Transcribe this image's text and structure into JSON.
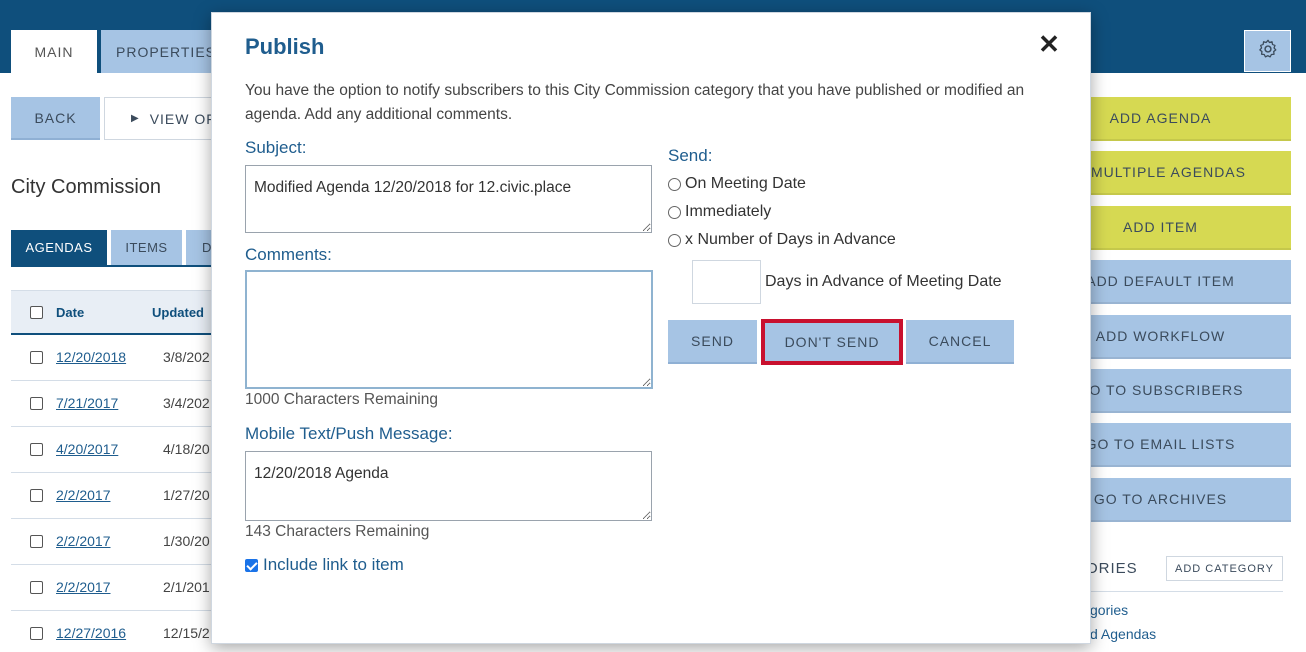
{
  "app": {
    "tabs": [
      {
        "label": "MAIN"
      },
      {
        "label": "PROPERTIES"
      }
    ],
    "back_label": "BACK",
    "view_label": "VIEW OF",
    "heading": "City Commission",
    "subtabs": [
      {
        "label": "AGENDAS"
      },
      {
        "label": "ITEMS"
      },
      {
        "label": "D"
      }
    ],
    "table": {
      "headers": {
        "date": "Date",
        "updated": "Updated"
      },
      "rows": [
        {
          "date": "12/20/2018",
          "updated": "3/8/202"
        },
        {
          "date": "7/21/2017",
          "updated": "3/4/202"
        },
        {
          "date": "4/20/2017",
          "updated": "4/18/20"
        },
        {
          "date": "2/2/2017",
          "updated": "1/27/20"
        },
        {
          "date": "2/2/2017",
          "updated": "1/30/20"
        },
        {
          "date": "2/2/2017",
          "updated": "2/1/201"
        },
        {
          "date": "12/27/2016",
          "updated": "12/15/2"
        }
      ]
    },
    "right_buttons": [
      {
        "label": "ADD AGENDA",
        "style": "yellow"
      },
      {
        "label": "D MULTIPLE AGENDAS",
        "style": "yellow"
      },
      {
        "label": "ADD ITEM",
        "style": "yellow"
      },
      {
        "label": "ADD DEFAULT ITEM",
        "style": "blue"
      },
      {
        "label": "ADD WORKFLOW",
        "style": "blue"
      },
      {
        "label": "GO TO SUBSCRIBERS",
        "style": "blue"
      },
      {
        "label": "GO TO EMAIL LISTS",
        "style": "blue"
      },
      {
        "label": "GO TO ARCHIVES",
        "style": "blue"
      }
    ],
    "categories_heading": "ORIES",
    "add_category_label": "ADD CATEGORY",
    "category_links": [
      "gories",
      "d Agendas"
    ],
    "colors": {
      "primary": "#0f4f7c",
      "light_blue": "#a6c4e4",
      "yellow": "#d6d952",
      "highlight": "#c8102e"
    }
  },
  "modal": {
    "title": "Publish",
    "close_icon": "close-icon",
    "intro": "You have the option to notify subscribers to this City Commission category that you have published or modified an agenda. Add any additional comments.",
    "subject_label": "Subject:",
    "subject_value": "Modified Agenda 12/20/2018 for 12.civic.place",
    "comments_label": "Comments:",
    "comments_value": "",
    "comments_remaining": "1000 Characters Remaining",
    "mobile_label": "Mobile Text/Push Message:",
    "mobile_value": "12/20/2018 Agenda",
    "mobile_remaining": "143 Characters Remaining",
    "include_link_label": "Include link to item",
    "include_link_checked": true,
    "send_label": "Send:",
    "send_options": [
      {
        "label": "On Meeting Date"
      },
      {
        "label": "Immediately"
      },
      {
        "label": "x Number of Days in Advance"
      }
    ],
    "days_label": "Days in Advance of Meeting Date",
    "days_value": "",
    "buttons": {
      "send": "SEND",
      "dont_send": "DON'T SEND",
      "cancel": "CANCEL"
    }
  }
}
